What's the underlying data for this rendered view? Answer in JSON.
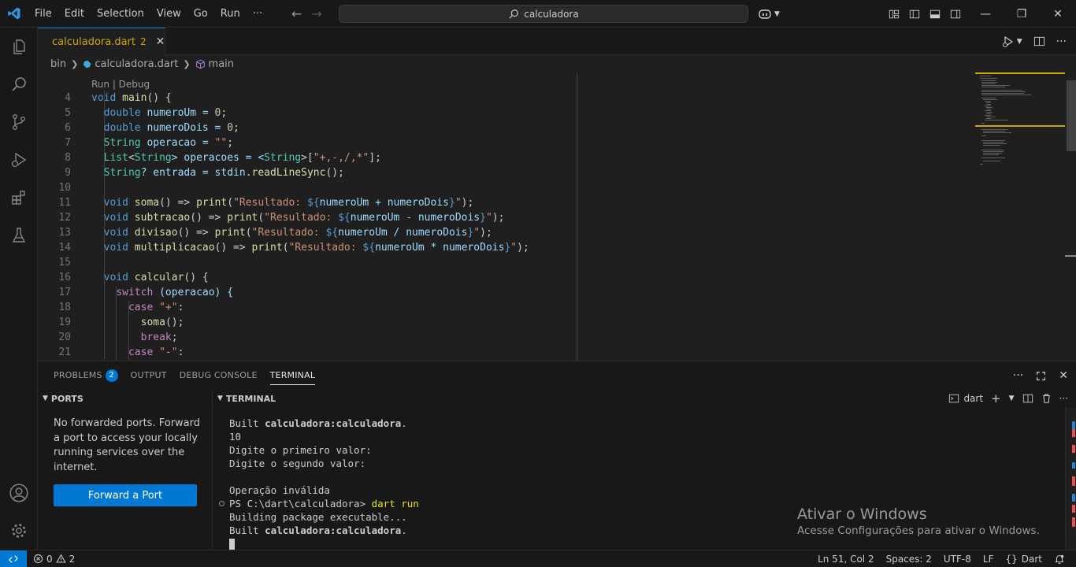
{
  "titlebar": {
    "menu": [
      "File",
      "Edit",
      "Selection",
      "View",
      "Go",
      "Run",
      "···"
    ],
    "search_text": "calculadora"
  },
  "tab": {
    "label": "calculadora.dart",
    "problem_count": "2"
  },
  "breadcrumb": {
    "folder": "bin",
    "file": "calculadora.dart",
    "symbol": "main"
  },
  "editor": {
    "codelens": "Run | Debug",
    "lines": [
      {
        "n": "4",
        "tokens": [
          [
            "void",
            "#569cd6"
          ],
          [
            " ",
            ""
          ],
          [
            "main",
            "#dcdcaa"
          ],
          [
            "() {",
            "#cccccc"
          ]
        ]
      },
      {
        "n": "5",
        "tokens": [
          [
            "  ",
            ""
          ],
          [
            "double",
            "#569cd6"
          ],
          [
            " numeroUm = ",
            "#9cdcfe"
          ],
          [
            "0",
            "#b5cea8"
          ],
          [
            ";",
            "#cccccc"
          ]
        ]
      },
      {
        "n": "6",
        "tokens": [
          [
            "  ",
            ""
          ],
          [
            "double",
            "#569cd6"
          ],
          [
            " numeroDois = ",
            "#9cdcfe"
          ],
          [
            "0",
            "#b5cea8"
          ],
          [
            ";",
            "#cccccc"
          ]
        ]
      },
      {
        "n": "7",
        "tokens": [
          [
            "  ",
            ""
          ],
          [
            "String",
            "#4ec9b0"
          ],
          [
            " operacao = ",
            "#9cdcfe"
          ],
          [
            "\"\"",
            "#ce9178"
          ],
          [
            ";",
            "#cccccc"
          ]
        ]
      },
      {
        "n": "8",
        "tokens": [
          [
            "  ",
            ""
          ],
          [
            "List",
            "#4ec9b0"
          ],
          [
            "<",
            "#cccccc"
          ],
          [
            "String",
            "#4ec9b0"
          ],
          [
            "> operacoes = <",
            "#9cdcfe"
          ],
          [
            "String",
            "#4ec9b0"
          ],
          [
            ">[",
            "#cccccc"
          ],
          [
            "\"+,-,/,*\"",
            "#ce9178"
          ],
          [
            "];",
            "#cccccc"
          ]
        ]
      },
      {
        "n": "9",
        "tokens": [
          [
            "  ",
            ""
          ],
          [
            "String",
            "#4ec9b0"
          ],
          [
            "? entrada = ",
            "#9cdcfe"
          ],
          [
            "stdin",
            "#9cdcfe"
          ],
          [
            ".",
            "#cccccc"
          ],
          [
            "readLineSync",
            "#dcdcaa"
          ],
          [
            "();",
            "#cccccc"
          ]
        ]
      },
      {
        "n": "10",
        "tokens": []
      },
      {
        "n": "11",
        "tokens": [
          [
            "  ",
            ""
          ],
          [
            "void",
            "#569cd6"
          ],
          [
            " ",
            ""
          ],
          [
            "soma",
            "#dcdcaa"
          ],
          [
            "() => ",
            "#cccccc"
          ],
          [
            "print",
            "#dcdcaa"
          ],
          [
            "(",
            "#cccccc"
          ],
          [
            "\"Resultado: ",
            "#ce9178"
          ],
          [
            "${",
            "#569cd6"
          ],
          [
            "numeroUm + numeroDois",
            "#9cdcfe"
          ],
          [
            "}",
            "#569cd6"
          ],
          [
            "\"",
            "#ce9178"
          ],
          [
            ");",
            "#cccccc"
          ]
        ]
      },
      {
        "n": "12",
        "tokens": [
          [
            "  ",
            ""
          ],
          [
            "void",
            "#569cd6"
          ],
          [
            " ",
            ""
          ],
          [
            "subtracao",
            "#dcdcaa"
          ],
          [
            "() => ",
            "#cccccc"
          ],
          [
            "print",
            "#dcdcaa"
          ],
          [
            "(",
            "#cccccc"
          ],
          [
            "\"Resultado: ",
            "#ce9178"
          ],
          [
            "${",
            "#569cd6"
          ],
          [
            "numeroUm - numeroDois",
            "#9cdcfe"
          ],
          [
            "}",
            "#569cd6"
          ],
          [
            "\"",
            "#ce9178"
          ],
          [
            ");",
            "#cccccc"
          ]
        ]
      },
      {
        "n": "13",
        "tokens": [
          [
            "  ",
            ""
          ],
          [
            "void",
            "#569cd6"
          ],
          [
            " ",
            ""
          ],
          [
            "divisao",
            "#dcdcaa"
          ],
          [
            "() => ",
            "#cccccc"
          ],
          [
            "print",
            "#dcdcaa"
          ],
          [
            "(",
            "#cccccc"
          ],
          [
            "\"Resultado: ",
            "#ce9178"
          ],
          [
            "${",
            "#569cd6"
          ],
          [
            "numeroUm / numeroDois",
            "#9cdcfe"
          ],
          [
            "}",
            "#569cd6"
          ],
          [
            "\"",
            "#ce9178"
          ],
          [
            ");",
            "#cccccc"
          ]
        ]
      },
      {
        "n": "14",
        "tokens": [
          [
            "  ",
            ""
          ],
          [
            "void",
            "#569cd6"
          ],
          [
            " ",
            ""
          ],
          [
            "multiplicacao",
            "#dcdcaa"
          ],
          [
            "() => ",
            "#cccccc"
          ],
          [
            "print",
            "#dcdcaa"
          ],
          [
            "(",
            "#cccccc"
          ],
          [
            "\"Resultado: ",
            "#ce9178"
          ],
          [
            "${",
            "#569cd6"
          ],
          [
            "numeroUm * numeroDois",
            "#9cdcfe"
          ],
          [
            "}",
            "#569cd6"
          ],
          [
            "\"",
            "#ce9178"
          ],
          [
            ");",
            "#cccccc"
          ]
        ]
      },
      {
        "n": "15",
        "tokens": []
      },
      {
        "n": "16",
        "tokens": [
          [
            "  ",
            ""
          ],
          [
            "void",
            "#569cd6"
          ],
          [
            " ",
            ""
          ],
          [
            "calcular",
            "#dcdcaa"
          ],
          [
            "() {",
            "#cccccc"
          ]
        ]
      },
      {
        "n": "17",
        "tokens": [
          [
            "    ",
            ""
          ],
          [
            "switch",
            "#c586c0"
          ],
          [
            " (operacao) {",
            "#9cdcfe"
          ]
        ]
      },
      {
        "n": "18",
        "tokens": [
          [
            "      ",
            ""
          ],
          [
            "case",
            "#c586c0"
          ],
          [
            " ",
            ""
          ],
          [
            "\"+\"",
            "#ce9178"
          ],
          [
            ":",
            "#cccccc"
          ]
        ]
      },
      {
        "n": "19",
        "tokens": [
          [
            "        ",
            ""
          ],
          [
            "soma",
            "#dcdcaa"
          ],
          [
            "();",
            "#cccccc"
          ]
        ]
      },
      {
        "n": "20",
        "tokens": [
          [
            "        ",
            ""
          ],
          [
            "break",
            "#c586c0"
          ],
          [
            ";",
            "#cccccc"
          ]
        ]
      },
      {
        "n": "21",
        "tokens": [
          [
            "      ",
            ""
          ],
          [
            "case",
            "#c586c0"
          ],
          [
            " ",
            ""
          ],
          [
            "\"-\"",
            "#ce9178"
          ],
          [
            ":",
            "#cccccc"
          ]
        ]
      }
    ]
  },
  "panel": {
    "tabs": [
      "PROBLEMS",
      "OUTPUT",
      "DEBUG CONSOLE",
      "TERMINAL"
    ],
    "problems_badge": "2",
    "ports_title": "PORTS",
    "ports_message": "No forwarded ports. Forward a port to access your locally running services over the internet.",
    "forward_button": "Forward a Port",
    "terminal_title": "TERMINAL",
    "terminal_shell": "dart",
    "terminal_lines": [
      {
        "parts": [
          [
            "Built ",
            false
          ],
          [
            "calculadora:calculadora",
            true
          ],
          [
            ".",
            false
          ]
        ]
      },
      {
        "parts": [
          [
            "10",
            false
          ]
        ]
      },
      {
        "parts": [
          [
            "Digite o primeiro valor:",
            false
          ]
        ]
      },
      {
        "parts": [
          [
            "Digite o segundo valor:",
            false
          ]
        ]
      },
      {
        "parts": [
          [
            "",
            false
          ]
        ]
      },
      {
        "parts": [
          [
            "Operação inválida",
            false
          ]
        ]
      },
      {
        "parts": [
          [
            "PS C:\\dart\\calculadora> ",
            false
          ],
          [
            "dart run",
            "cmd"
          ]
        ],
        "dot": true
      },
      {
        "parts": [
          [
            "Building package executable...",
            false
          ]
        ]
      },
      {
        "parts": [
          [
            "Built ",
            false
          ],
          [
            "calculadora:calculadora",
            true
          ],
          [
            ".",
            false
          ]
        ]
      }
    ]
  },
  "watermark": {
    "title": "Ativar o Windows",
    "subtitle": "Acesse Configurações para ativar o Windows."
  },
  "statusbar": {
    "errors": "0",
    "warnings": "2",
    "position": "Ln 51, Col 2",
    "spaces": "Spaces: 2",
    "encoding": "UTF-8",
    "eol": "LF",
    "language": "Dart"
  },
  "colors": {
    "accent": "#0078d4",
    "warning_tab": "#cca700"
  }
}
